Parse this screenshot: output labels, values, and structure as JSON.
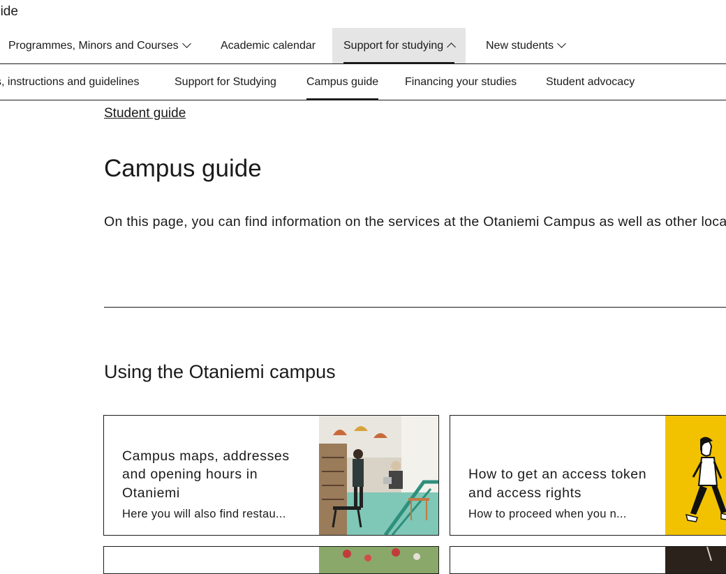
{
  "header": {
    "site_title": "uide"
  },
  "nav_primary": [
    {
      "label": "Programmes, Minors and Courses",
      "chevron": "down"
    },
    {
      "label": "Academic calendar"
    },
    {
      "label": "Support for studying",
      "chevron": "up",
      "active": true
    },
    {
      "label": "New students",
      "chevron": "down"
    }
  ],
  "nav_secondary": [
    {
      "label": "s, instructions and guidelines"
    },
    {
      "label": "Support for Studying"
    },
    {
      "label": "Campus guide",
      "active": true
    },
    {
      "label": "Financing your studies"
    },
    {
      "label": "Student advocacy"
    }
  ],
  "breadcrumb": "Student guide",
  "page_title": "Campus guide",
  "intro": "On this page, you can find information on the services at the Otaniemi Campus as well as other locations.",
  "section_title": "Using the Otaniemi campus",
  "cards": [
    {
      "title": "Campus maps, addresses and opening hours in Otaniemi",
      "description": "Here you will also find restau...",
      "image": "campus-interior-photo"
    },
    {
      "title": "How to get an access token and access rights",
      "description": "How to proceed when you n...",
      "image": "walking-person-illustration",
      "image_bg": "#f2c200"
    }
  ],
  "colors": {
    "text": "#1a1a1a",
    "active_tab_bg": "#e5e5e5",
    "illustration_yellow": "#f2c200"
  }
}
